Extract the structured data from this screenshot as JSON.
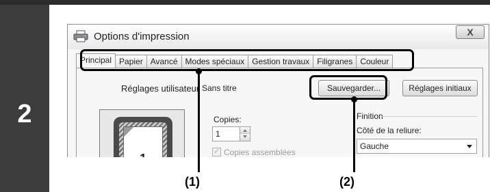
{
  "step": {
    "number": "2"
  },
  "dialog": {
    "title": "Options d'impression",
    "close_glyph": "X",
    "tabs": [
      {
        "label": "Principal",
        "active": true
      },
      {
        "label": "Papier",
        "active": false
      },
      {
        "label": "Avancé",
        "active": false
      },
      {
        "label": "Modes spéciaux",
        "active": false
      },
      {
        "label": "Gestion travaux",
        "active": false
      },
      {
        "label": "Filigranes",
        "active": false
      },
      {
        "label": "Couleur",
        "active": false
      }
    ],
    "user_settings": {
      "label": "Réglages utilisateur",
      "value": "Sans titre",
      "save_label": "Sauvegarder...",
      "reset_label": "Réglages initiaux"
    },
    "preview": {
      "page_number": "1"
    },
    "copies": {
      "label": "Copies:",
      "value": "1"
    },
    "collate": {
      "label": "Copies assemblées",
      "checked": true,
      "enabled": false
    },
    "finishing": {
      "group_label": "Finition",
      "binding_label": "Côté de la reliure:",
      "binding_value": "Gauche"
    }
  },
  "callouts": {
    "tabs_caption": "(1)",
    "save_caption": "(2)"
  },
  "colors": {
    "step_background": "#3c3c3c",
    "callout": "#000000"
  },
  "icons": {
    "window": "printer-icon",
    "close": "close-icon"
  }
}
